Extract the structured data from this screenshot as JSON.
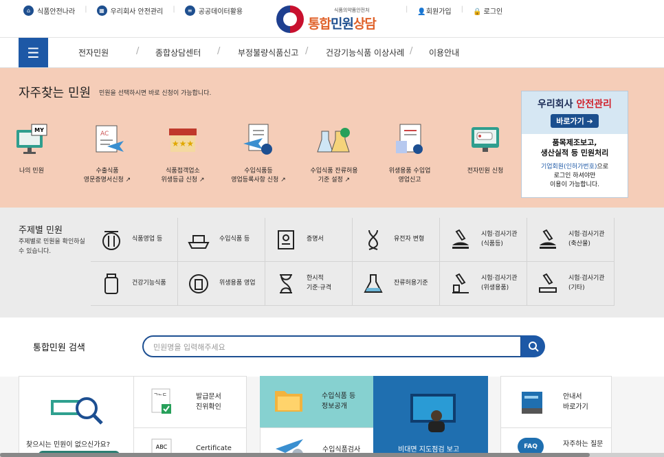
{
  "top_links": [
    {
      "label": "식품안전나라",
      "icon": "home-icon"
    },
    {
      "label": "우리회사 안전관리",
      "icon": "building-icon"
    },
    {
      "label": "공공데이터활용",
      "icon": "list-icon"
    }
  ],
  "logo": {
    "sub": "식품의약품안전처",
    "main_a": "통합",
    "main_b": "민원",
    "main_c": "상담"
  },
  "auth": {
    "join": "회원가입",
    "login": "로그인"
  },
  "nav": [
    "전자민원",
    "종합상담센터",
    "부정불량식품신고",
    "건강기능식품 이상사례",
    "이용안내"
  ],
  "frequent": {
    "title": "자주찾는 민원",
    "subtitle": "민원을 선택하시면 바로 신청이 가능합니다.",
    "items": [
      {
        "line1": "나의 민원",
        "line2": ""
      },
      {
        "line1": "수출식품",
        "line2": "영문증명서신청"
      },
      {
        "line1": "식품접객업소",
        "line2": "위생등급 신청"
      },
      {
        "line1": "수입식품등",
        "line2": "영업등록사항 신청"
      },
      {
        "line1": "수입식품 잔류허용",
        "line2": "기준 설정"
      },
      {
        "line1": "위생용품 수입업",
        "line2": "영업신고"
      },
      {
        "line1": "전자민원 신청",
        "line2": ""
      }
    ],
    "monitor_badge": "MY"
  },
  "banner": {
    "title_a": "우리회사 ",
    "title_b": "안전관리",
    "button": "바로가기",
    "line1": "품목제조보고,",
    "line2": "생산실적 등 민원처리",
    "line3_a": "기업회원(인허가번호)",
    "line3_b": "으로",
    "line4": "로그인 하셔야만",
    "line5": "이용이 가능합니다."
  },
  "topics": {
    "title": "주제별 민원",
    "subtitle": "주제별로 민원을 확인하실 수 있습니다.",
    "row1": [
      {
        "line1": "식품영업 등",
        "line2": "",
        "icon": "utensils-icon"
      },
      {
        "line1": "수입식품 등",
        "line2": "",
        "icon": "ship-icon"
      },
      {
        "line1": "증명서",
        "line2": "",
        "icon": "certificate-icon"
      },
      {
        "line1": "유전자 변형",
        "line2": "",
        "icon": "dna-icon"
      },
      {
        "line1": "시험·검사기관",
        "line2": "(식품등)",
        "icon": "microscope-icon"
      },
      {
        "line1": "시험·검사기관",
        "line2": "(축산물)",
        "icon": "microscope-icon"
      }
    ],
    "row2": [
      {
        "line1": "건강기능식품",
        "line2": "",
        "icon": "bottle-icon"
      },
      {
        "line1": "위생용품 영업",
        "line2": "",
        "icon": "cup-icon"
      },
      {
        "line1": "한시적",
        "line2": "기준·규격",
        "icon": "hourglass-icon"
      },
      {
        "line1": "잔류허용기준",
        "line2": "",
        "icon": "flask-icon"
      },
      {
        "line1": "시험·검사기관",
        "line2": "(위생용품)",
        "icon": "microscope-icon"
      },
      {
        "line1": "시험·검사기관",
        "line2": "(기타)",
        "icon": "microscope-icon"
      }
    ]
  },
  "search": {
    "title": "통합민원 검색",
    "placeholder": "민원명을 입력해주세요"
  },
  "cards": {
    "help": "찾으시는 민원이 없으신가요?",
    "issued_line1": "발급문서",
    "issued_line2": "진위확인",
    "certificate": "Certificate",
    "cert_icon_text": "ABC",
    "doc_icon_text": "ᄀᄂᄃ",
    "import_info_line1": "수입식품 등",
    "import_info_line2": "정보공개",
    "import_inspect": "수입식품검사",
    "online": "비대면 지도점검 보고",
    "guide_line1": "안내서",
    "guide_line2": "바로가기",
    "faq_badge": "FAQ",
    "faq": "자주하는 질문"
  },
  "colors": {
    "primary": "#1d58a6",
    "frequent_bg": "#f5cdb8",
    "topic_bg": "#ebebeb",
    "accent_orange": "#e0622a"
  }
}
